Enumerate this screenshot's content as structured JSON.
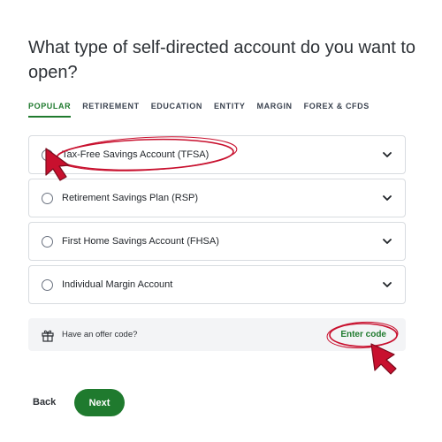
{
  "page_title": "What type of self-directed account do you want to open?",
  "tabs": [
    {
      "label": "POPULAR",
      "active": true
    },
    {
      "label": "RETIREMENT",
      "active": false
    },
    {
      "label": "EDUCATION",
      "active": false
    },
    {
      "label": "ENTITY",
      "active": false
    },
    {
      "label": "MARGIN",
      "active": false
    },
    {
      "label": "FOREX & CFDS",
      "active": false
    }
  ],
  "options": [
    {
      "label": "Tax-Free Savings Account (TFSA)",
      "icon": "chevron-down-icon"
    },
    {
      "label": "Retirement Savings Plan (RSP)",
      "icon": "chevron-down-icon"
    },
    {
      "label": "First Home Savings Account (FHSA)",
      "icon": "chevron-down-icon"
    },
    {
      "label": "Individual Margin Account",
      "icon": "chevron-down-icon"
    }
  ],
  "offer": {
    "label": "Have an offer code?",
    "action": "Enter code",
    "icon": "gift-icon"
  },
  "footer": {
    "back_label": "Back",
    "next_label": "Next"
  },
  "colors": {
    "accent": "#1f7a2e",
    "annotation": "#c8102e"
  }
}
